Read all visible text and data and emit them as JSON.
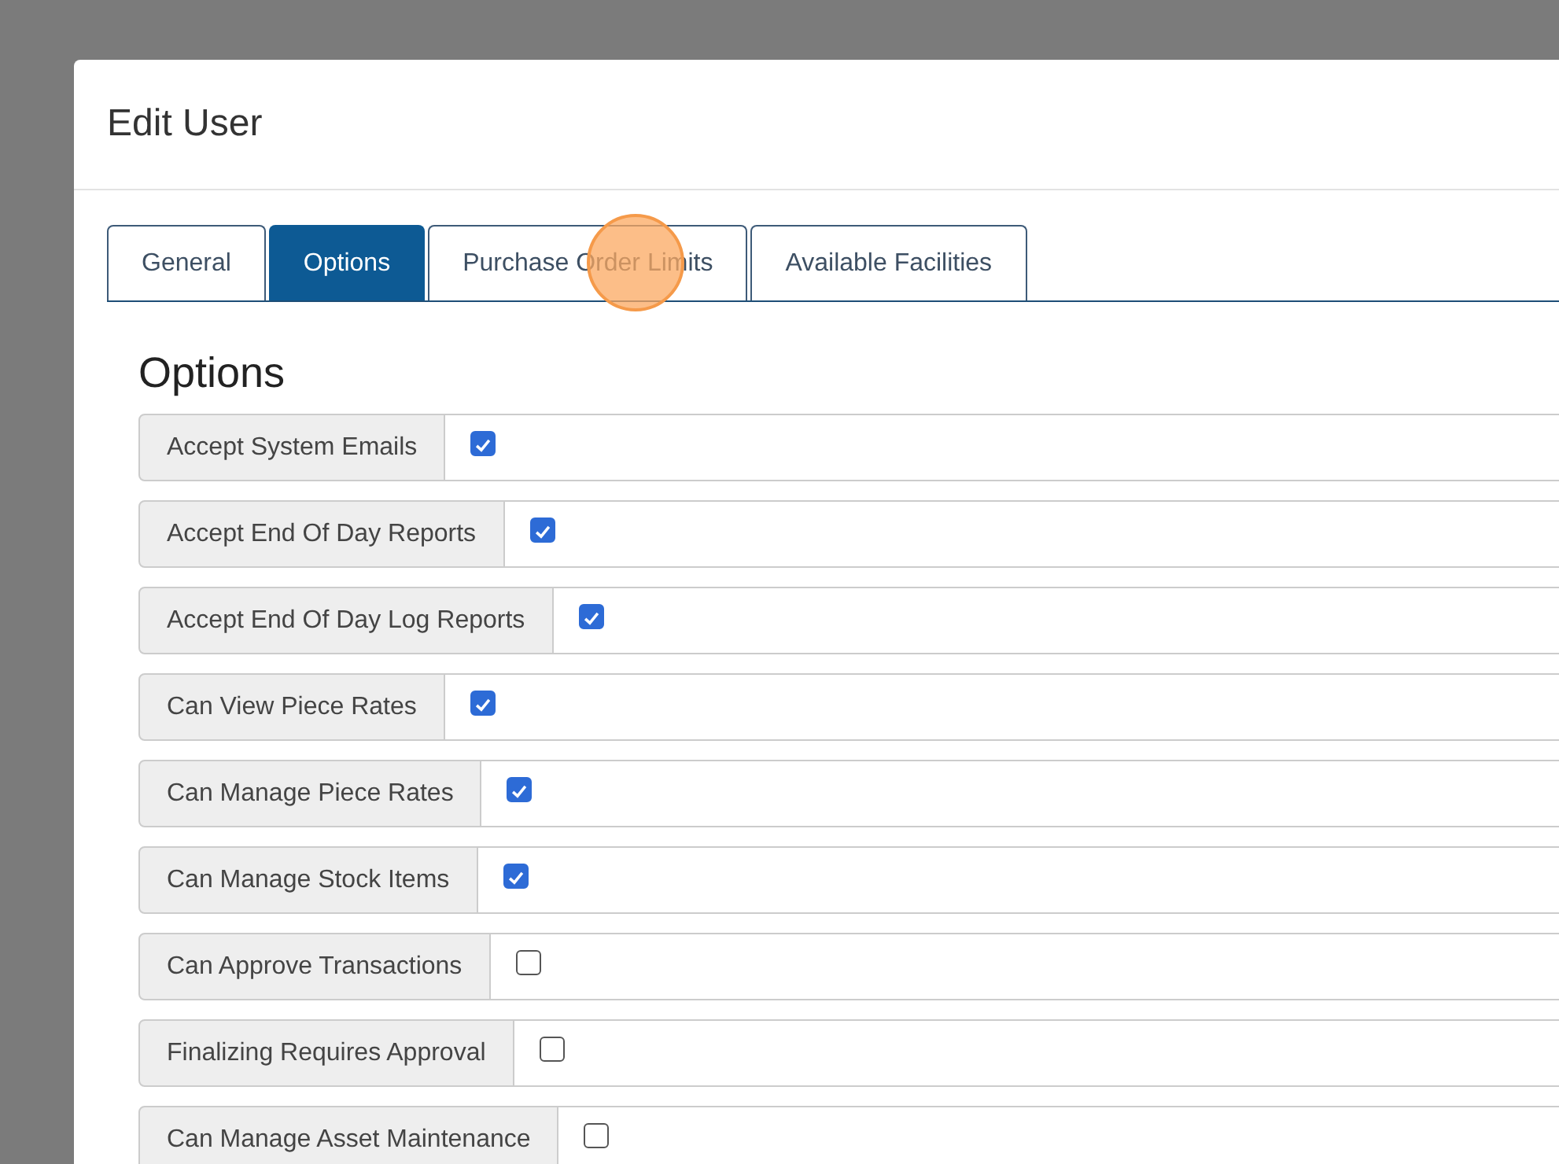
{
  "dialog": {
    "title": "Edit User"
  },
  "tabs": [
    {
      "label": "General",
      "selected": false
    },
    {
      "label": "Options",
      "selected": true
    },
    {
      "label": "Purchase Order Limits",
      "selected": false
    },
    {
      "label": "Available Facilities",
      "selected": false
    }
  ],
  "section": {
    "heading": "Options"
  },
  "options": [
    {
      "label": "Accept System Emails",
      "checked": true
    },
    {
      "label": "Accept End Of Day Reports",
      "checked": true
    },
    {
      "label": "Accept End Of Day Log Reports",
      "checked": true
    },
    {
      "label": "Can View Piece Rates",
      "checked": true
    },
    {
      "label": "Can Manage Piece Rates",
      "checked": true
    },
    {
      "label": "Can Manage Stock Items",
      "checked": true
    },
    {
      "label": "Can Approve Transactions",
      "checked": false
    },
    {
      "label": "Finalizing Requires Approval",
      "checked": false
    },
    {
      "label": "Can Manage Asset Maintenance",
      "checked": false
    }
  ]
}
